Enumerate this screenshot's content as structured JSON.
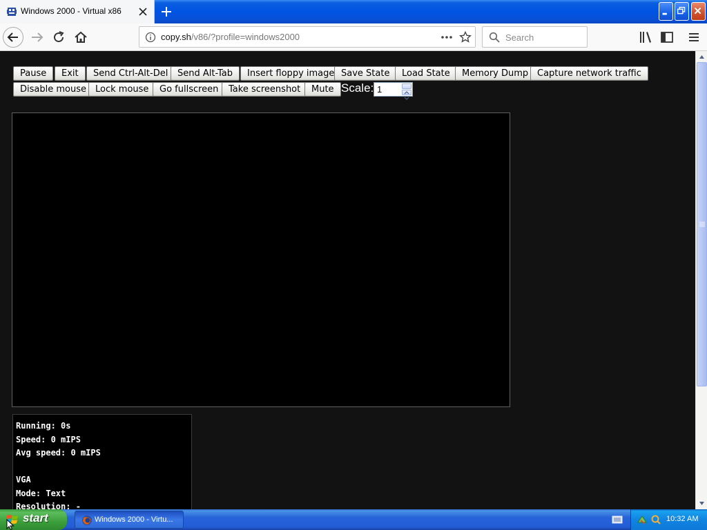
{
  "browser": {
    "tab_title": "Windows 2000 - Virtual x86",
    "url_host": "copy.sh",
    "url_path": "/v86/?profile=windows2000",
    "search_placeholder": "Search"
  },
  "toolbar": {
    "row1": [
      "Pause",
      "Exit",
      "Send Ctrl-Alt-Del",
      "Send Alt-Tab",
      "Insert floppy image",
      "Save State",
      "Load State",
      "Memory Dump",
      "Capture network traffic"
    ],
    "row2": [
      "Disable mouse",
      "Lock mouse",
      "Go fullscreen",
      "Take screenshot",
      "Mute"
    ],
    "scale_label": "Scale:",
    "scale_value": "1"
  },
  "info": {
    "lines": [
      "Running: 0s",
      "Speed: 0 mIPS",
      "Avg speed: 0 mIPS",
      "",
      "VGA",
      "Mode: Text",
      "Resolution: -"
    ]
  },
  "taskbar": {
    "start_label": "start",
    "task_label": "Windows 2000 - Virtu...",
    "clock": "10:32 AM"
  },
  "colors": {
    "page_background": "#121212",
    "xp_blue": "#0054e3",
    "start_green": "#3c9f3c"
  }
}
